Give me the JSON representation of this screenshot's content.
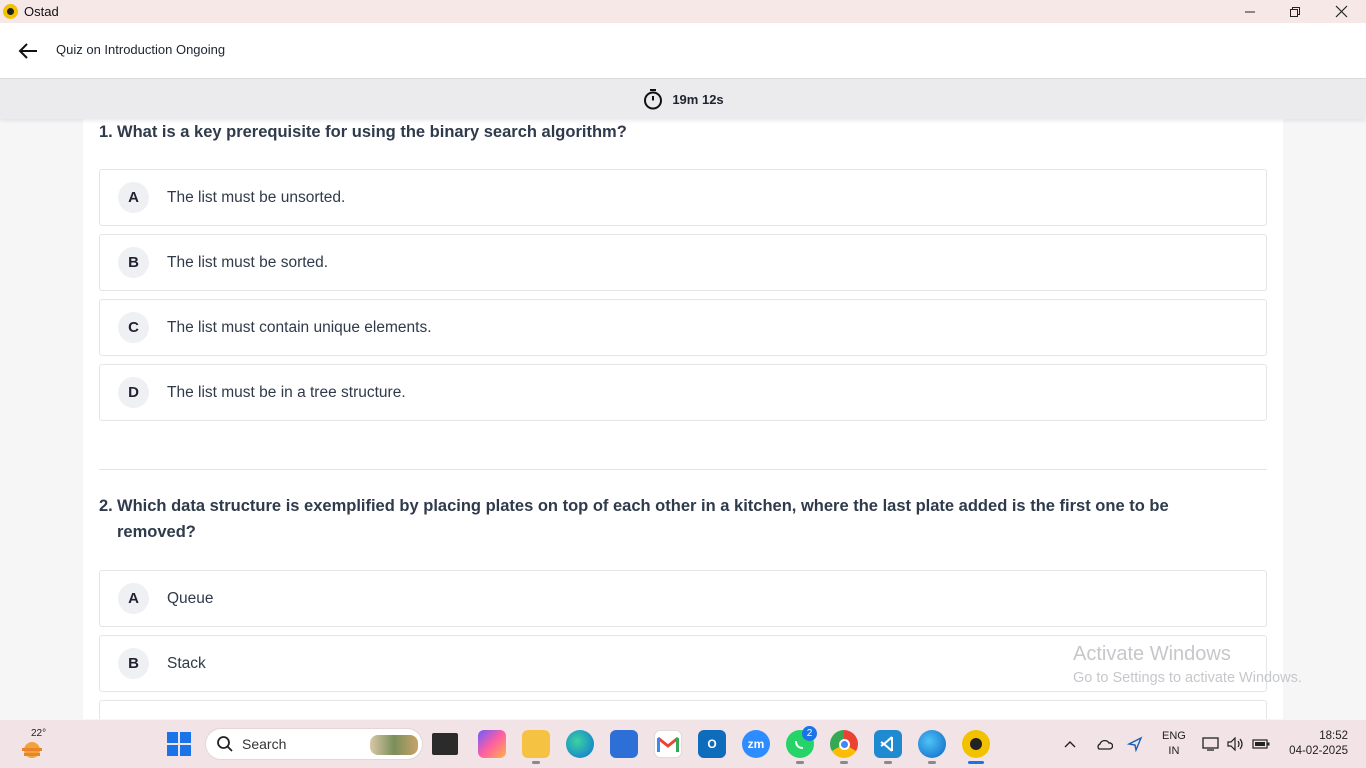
{
  "window": {
    "app_name": "Ostad"
  },
  "header": {
    "title": "Quiz on Introduction Ongoing",
    "timer": "19m 12s"
  },
  "questions": [
    {
      "number": "1.",
      "text": "What is a key prerequisite for using the binary search algorithm?",
      "options": [
        {
          "letter": "A",
          "text": "The list must be unsorted."
        },
        {
          "letter": "B",
          "text": "The list must be sorted."
        },
        {
          "letter": "C",
          "text": "The list must contain unique elements."
        },
        {
          "letter": "D",
          "text": "The list must be in a tree structure."
        }
      ]
    },
    {
      "number": "2.",
      "text": "Which data structure is exemplified by placing plates on top of each other in a kitchen, where the last plate added is the first one to be removed?",
      "options": [
        {
          "letter": "A",
          "text": "Queue"
        },
        {
          "letter": "B",
          "text": "Stack"
        }
      ]
    }
  ],
  "watermark": {
    "line1": "Activate Windows",
    "line2": "Go to Settings to activate Windows."
  },
  "taskbar": {
    "temperature": "22°",
    "search_label": "Search",
    "whatsapp_badge": "2",
    "language": "ENG",
    "region": "IN",
    "time": "18:52",
    "date": "04-02-2025",
    "zoom_label": "zm",
    "pinned_icons": [
      "file-explorer-icon",
      "copilot-icon",
      "folder-icon",
      "edge-icon",
      "store-icon",
      "gmail-icon",
      "outlook-icon",
      "zoom-icon",
      "whatsapp-icon",
      "chrome-icon",
      "vscode-icon",
      "edge-dev-icon",
      "ostad-icon"
    ]
  },
  "colors": {
    "titlebar": "#f7e8e8",
    "timerbar": "#ebebed",
    "taskbar": "#f1e3e6",
    "accent": "#f2c200"
  }
}
